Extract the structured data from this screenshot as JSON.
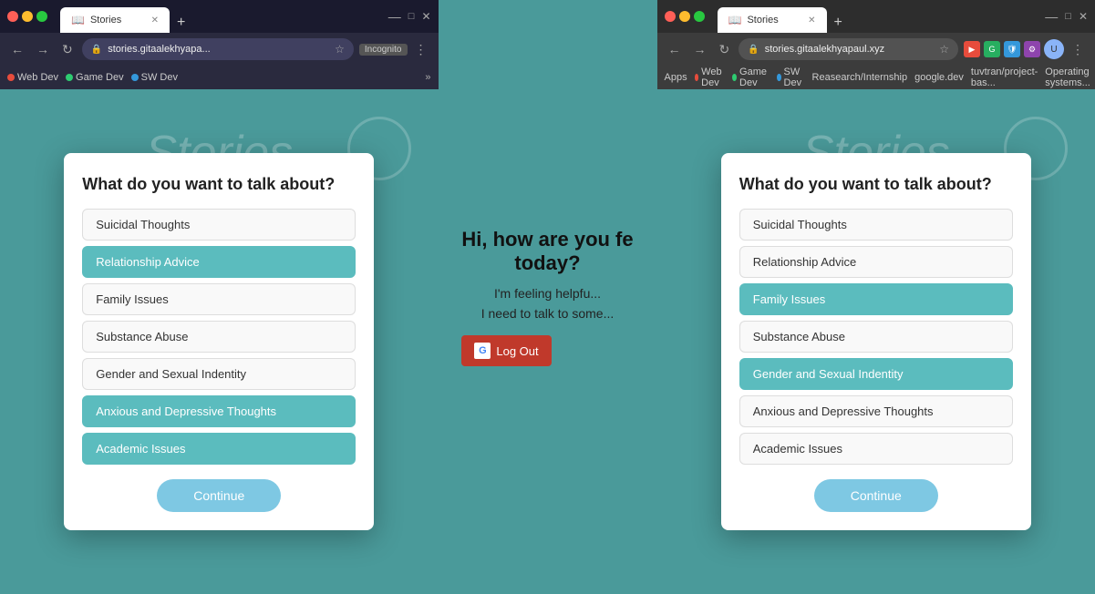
{
  "browser_left": {
    "tab_label": "Stories",
    "favicon": "📖",
    "address": "stories.gitaalekhyapa...",
    "incognito": true,
    "bookmarks": [
      "Web Dev",
      "Game Dev",
      "SW Dev"
    ],
    "modal": {
      "title": "What do you want to talk about?",
      "topics": [
        {
          "label": "Suicidal Thoughts",
          "selected": false
        },
        {
          "label": "Relationship Advice",
          "selected": true
        },
        {
          "label": "Family Issues",
          "selected": false
        },
        {
          "label": "Substance Abuse",
          "selected": false
        },
        {
          "label": "Gender and Sexual Indentity",
          "selected": false
        },
        {
          "label": "Anxious and Depressive Thoughts",
          "selected": true
        },
        {
          "label": "Academic Issues",
          "selected": true
        }
      ],
      "continue_label": "Continue"
    }
  },
  "browser_right": {
    "tab_label": "Stories",
    "favicon": "📖",
    "address": "stories.gitaalekhyapaul.xyz",
    "incognito": false,
    "bookmarks": [
      "Apps",
      "Web Dev",
      "Game Dev",
      "SW Dev",
      "Reasearch/Internship",
      "google.dev",
      "tuvtran/project-bas...",
      "Operating systems..."
    ],
    "modal": {
      "title": "What do you want to talk about?",
      "topics": [
        {
          "label": "Suicidal Thoughts",
          "selected": false
        },
        {
          "label": "Relationship Advice",
          "selected": false
        },
        {
          "label": "Family Issues",
          "selected": true
        },
        {
          "label": "Substance Abuse",
          "selected": false
        },
        {
          "label": "Gender and Sexual Indentity",
          "selected": true
        },
        {
          "label": "Anxious and Depressive Thoughts",
          "selected": false
        },
        {
          "label": "Academic Issues",
          "selected": false
        }
      ],
      "continue_label": "Continue"
    }
  },
  "middle": {
    "hi_text": "Hi, how are you fe...",
    "sub_text": "today?",
    "feeling_text": "I'm feeling helpfu...",
    "talk_text": "I need to talk to some...",
    "logout_label": "Log Out"
  },
  "page": {
    "stories_bg_text": "Stories",
    "stories_bg_text_right": "Stories"
  }
}
